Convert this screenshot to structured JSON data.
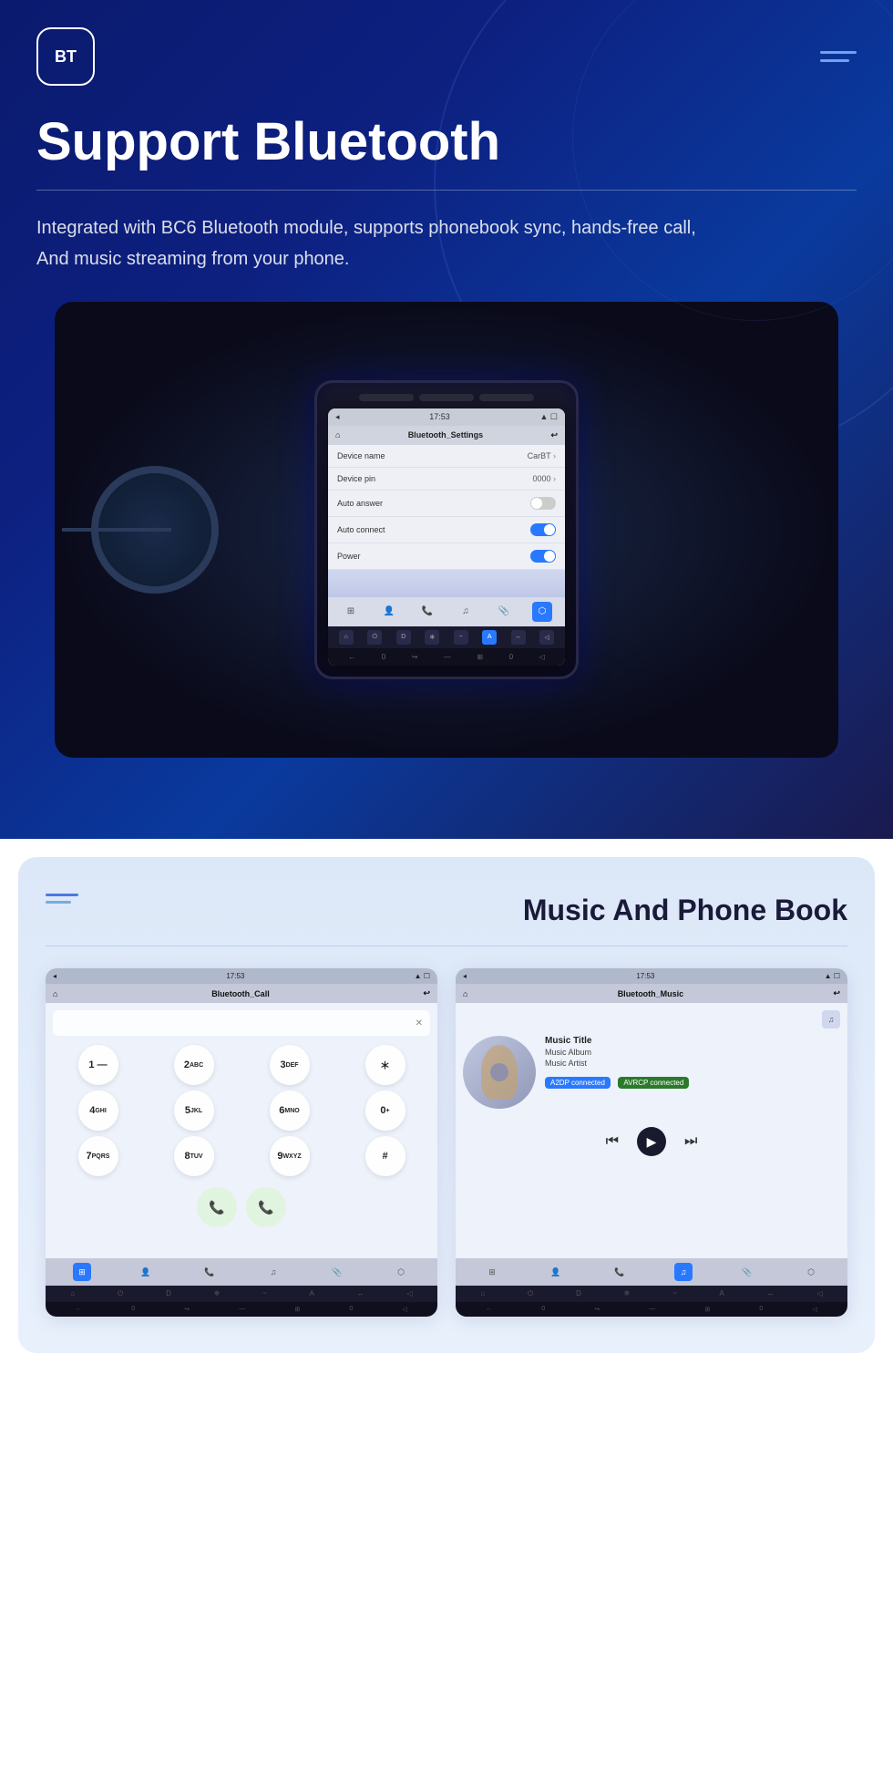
{
  "hero": {
    "logo_text": "BT",
    "title": "Support Bluetooth",
    "description_line1": "Integrated with BC6 Bluetooth module, supports phonebook sync, hands-free call,",
    "description_line2": "And music streaming from your phone."
  },
  "screen": {
    "statusbar_time": "17:53",
    "nav_title": "Bluetooth_Settings",
    "rows": [
      {
        "label": "Device name",
        "value": "CarBT",
        "type": "chevron"
      },
      {
        "label": "Device pin",
        "value": "0000",
        "type": "chevron"
      },
      {
        "label": "Auto answer",
        "value": "",
        "type": "toggle_off"
      },
      {
        "label": "Auto connect",
        "value": "",
        "type": "toggle_on"
      },
      {
        "label": "Power",
        "value": "",
        "type": "toggle_on"
      }
    ]
  },
  "section2": {
    "title": "Music And Phone Book",
    "call_screen": {
      "statusbar_time": "17:53",
      "nav_title": "Bluetooth_Call"
    },
    "music_screen": {
      "statusbar_time": "17:53",
      "nav_title": "Bluetooth_Music",
      "music_title": "Music Title",
      "music_album": "Music Album",
      "music_artist": "Music Artist",
      "badge1": "A2DP connected",
      "badge2": "AVRCP connected"
    },
    "dialpad": {
      "buttons": [
        "1 —",
        "2 ABC",
        "3 DEF",
        "＊",
        "4 GHI",
        "5 JKL",
        "6 MNO",
        "0 +",
        "7 PQRS",
        "8 TUV",
        "9 WXYZ",
        "#"
      ]
    }
  }
}
